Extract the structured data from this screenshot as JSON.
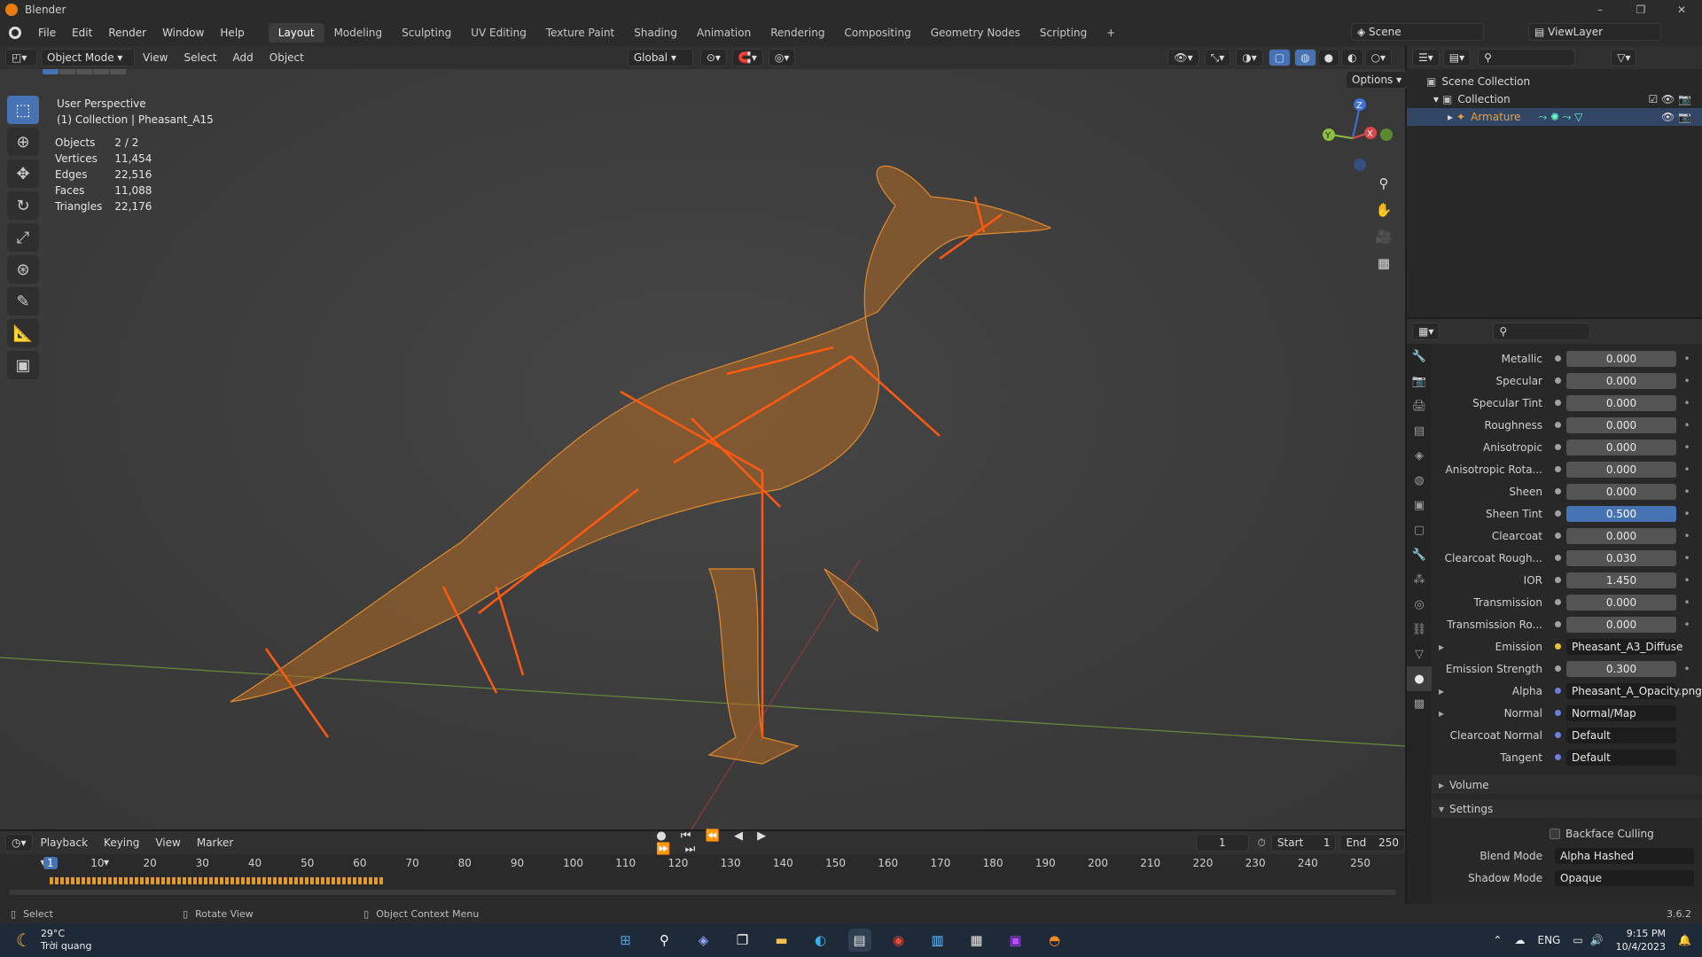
{
  "window": {
    "title": "Blender",
    "controls": [
      "–",
      "❐",
      "✕"
    ]
  },
  "menu": {
    "items": [
      "File",
      "Edit",
      "Render",
      "Window",
      "Help"
    ]
  },
  "workspaces": [
    "Layout",
    "Modeling",
    "Sculpting",
    "UV Editing",
    "Texture Paint",
    "Shading",
    "Animation",
    "Rendering",
    "Compositing",
    "Geometry Nodes",
    "Scripting"
  ],
  "workspace_add": "+",
  "scene": {
    "label": "Scene",
    "view_layer": "ViewLayer"
  },
  "viewport_header": {
    "mode": "Object Mode",
    "menus": [
      "View",
      "Select",
      "Add",
      "Object"
    ],
    "orientation": "Global",
    "options": "Options"
  },
  "viewport": {
    "perspective": "User Perspective",
    "collection": "(1) Collection | Pheasant_A15",
    "stats": [
      {
        "k": "Objects",
        "v": "2 / 2"
      },
      {
        "k": "Vertices",
        "v": "11,454"
      },
      {
        "k": "Edges",
        "v": "22,516"
      },
      {
        "k": "Faces",
        "v": "11,088"
      },
      {
        "k": "Triangles",
        "v": "22,176"
      }
    ],
    "gizmo": {
      "x": "X",
      "y": "Y",
      "z": "Z"
    }
  },
  "outliner": {
    "rows": [
      "Scene Collection",
      "Collection",
      "Armature"
    ]
  },
  "properties": {
    "rows": [
      {
        "label": "Metallic",
        "value": "0.000"
      },
      {
        "label": "Specular",
        "value": "0.000"
      },
      {
        "label": "Specular Tint",
        "value": "0.000"
      },
      {
        "label": "Roughness",
        "value": "0.000"
      },
      {
        "label": "Anisotropic",
        "value": "0.000"
      },
      {
        "label": "Anisotropic Rota...",
        "value": "0.000"
      },
      {
        "label": "Sheen",
        "value": "0.000"
      },
      {
        "label": "Sheen Tint",
        "value": "0.500"
      },
      {
        "label": "Clearcoat",
        "value": "0.000"
      },
      {
        "label": "Clearcoat Rough...",
        "value": "0.030"
      },
      {
        "label": "IOR",
        "value": "1.450"
      },
      {
        "label": "Transmission",
        "value": "0.000"
      },
      {
        "label": "Transmission Ro...",
        "value": "0.000"
      },
      {
        "label": "Emission",
        "value": "Pheasant_A3_Diffuse"
      },
      {
        "label": "Emission Strength",
        "value": "0.300"
      },
      {
        "label": "Alpha",
        "value": "Pheasant_A_Opacity.png"
      },
      {
        "label": "Normal",
        "value": "Normal/Map"
      },
      {
        "label": "Clearcoat Normal",
        "value": "Default"
      },
      {
        "label": "Tangent",
        "value": "Default"
      }
    ],
    "sections": {
      "volume": "Volume",
      "settings": "Settings"
    },
    "backface": "Backface Culling",
    "blend_mode": {
      "label": "Blend Mode",
      "value": "Alpha Hashed"
    },
    "shadow_mode": {
      "label": "Shadow Mode",
      "value": "Opaque"
    }
  },
  "timeline": {
    "menus": [
      "Playback",
      "Keying",
      "View",
      "Marker"
    ],
    "current_frame": "1",
    "start_label": "Start",
    "start": "1",
    "end_label": "End",
    "end": "250",
    "ruler": [
      "1",
      "10",
      "20",
      "30",
      "40",
      "50",
      "60",
      "70",
      "80",
      "90",
      "100",
      "110",
      "120",
      "130",
      "140",
      "150",
      "160",
      "170",
      "180",
      "190",
      "200",
      "210",
      "220",
      "230",
      "240",
      "250"
    ]
  },
  "statusbar": {
    "items": [
      "Select",
      "Rotate View",
      "Object Context Menu"
    ],
    "version": "3.6.2"
  },
  "taskbar": {
    "temp": "29°C",
    "weather": "Trời quang",
    "lang": "ENG",
    "time": "9:15 PM",
    "date": "10/4/2023"
  }
}
